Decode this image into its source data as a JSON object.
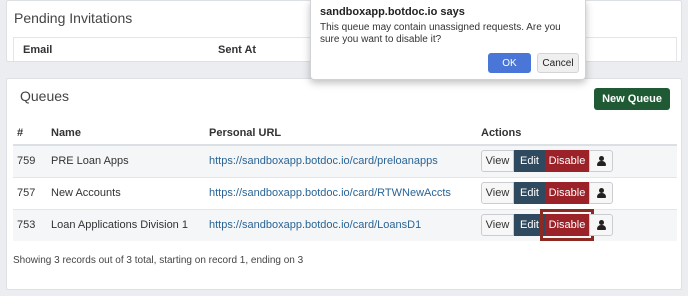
{
  "pending": {
    "title": "Pending Invitations",
    "col_email": "Email",
    "col_sent_at": "Sent At"
  },
  "queues": {
    "title": "Queues",
    "new_queue_label": "New Queue",
    "headers": {
      "num": "#",
      "name": "Name",
      "url": "Personal URL",
      "actions": "Actions"
    },
    "rows": [
      {
        "id": "759",
        "name": "PRE Loan Apps",
        "url": "https://sandboxapp.botdoc.io/card/preloanapps"
      },
      {
        "id": "757",
        "name": "New Accounts",
        "url": "https://sandboxapp.botdoc.io/card/RTWNewAccts"
      },
      {
        "id": "753",
        "name": "Loan Applications Division 1",
        "url": "https://sandboxapp.botdoc.io/card/LoansD1"
      }
    ],
    "action_labels": {
      "view": "View",
      "edit": "Edit",
      "disable": "Disable"
    },
    "summary": "Showing 3 records out of 3 total, starting on record 1, ending on 3"
  },
  "dialog": {
    "title": "sandboxapp.botdoc.io says",
    "message": "This queue may contain unassigned requests. Are you sure you want to disable it?",
    "ok_label": "OK",
    "cancel_label": "Cancel"
  },
  "icons": {
    "user": "user-icon"
  },
  "colors": {
    "new_queue": "#1f5a34",
    "edit": "#2f4a5e",
    "disable": "#9b2228",
    "ok": "#4a76d8",
    "highlight": "#8c2a21"
  }
}
